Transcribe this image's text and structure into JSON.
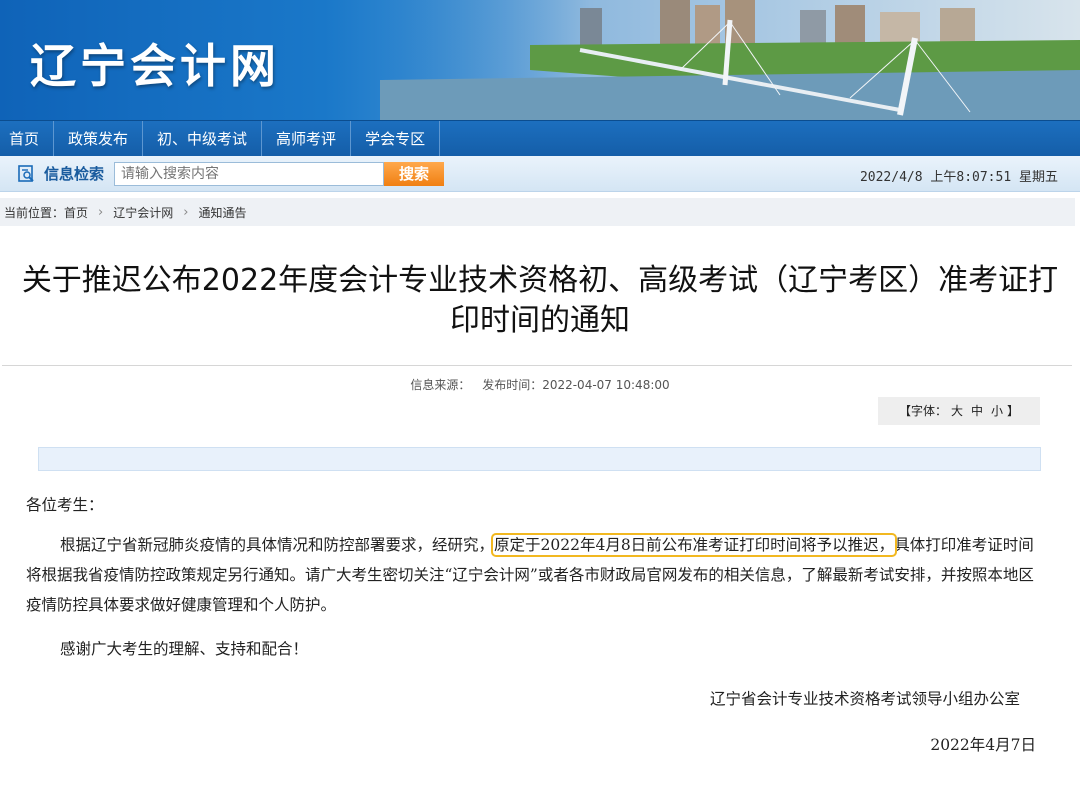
{
  "header": {
    "site_title": "辽宁会计网"
  },
  "nav": {
    "items": [
      "首页",
      "政策发布",
      "初、中级考试",
      "高师考评",
      "学会专区"
    ]
  },
  "search": {
    "label": "信息检索",
    "placeholder": "请输入搜索内容",
    "button": "搜索",
    "datetime": "2022/4/8 上午8:07:51 星期五"
  },
  "breadcrumb": {
    "prefix": "当前位置：",
    "items": [
      "首页",
      "辽宁会计网",
      "通知通告"
    ],
    "separator": "›"
  },
  "article": {
    "title": "关于推迟公布2022年度会计专业技术资格初、高级考试（辽宁考区）准考证打印时间的通知",
    "source_label": "信息来源：",
    "publish_time": "发布时间：2022-04-07 10:48:00",
    "font_label": "【字体：",
    "font_large": "大",
    "font_medium": "中",
    "font_small": "小",
    "font_close": "】",
    "greeting": "各位考生：",
    "para1_a": "根据辽宁省新冠肺炎疫情的具体情况和防控部署要求，经研究，",
    "para1_highlight": "原定于2022年4月8日前公布准考证打印时间将予以推迟，",
    "para1_b": "具体打印准考证时间将根据我省疫情防控政策规定另行通知。请广大考生密切关注“辽宁会计网”或者各市财政局官网发布的相关信息，了解最新考试安排，并按照本地区疫情防控具体要求做好健康管理和个人防护。",
    "thanks": "感谢广大考生的理解、支持和配合！",
    "signature": "辽宁省会计专业技术资格考试领导小组办公室",
    "date": "2022年4月7日"
  }
}
